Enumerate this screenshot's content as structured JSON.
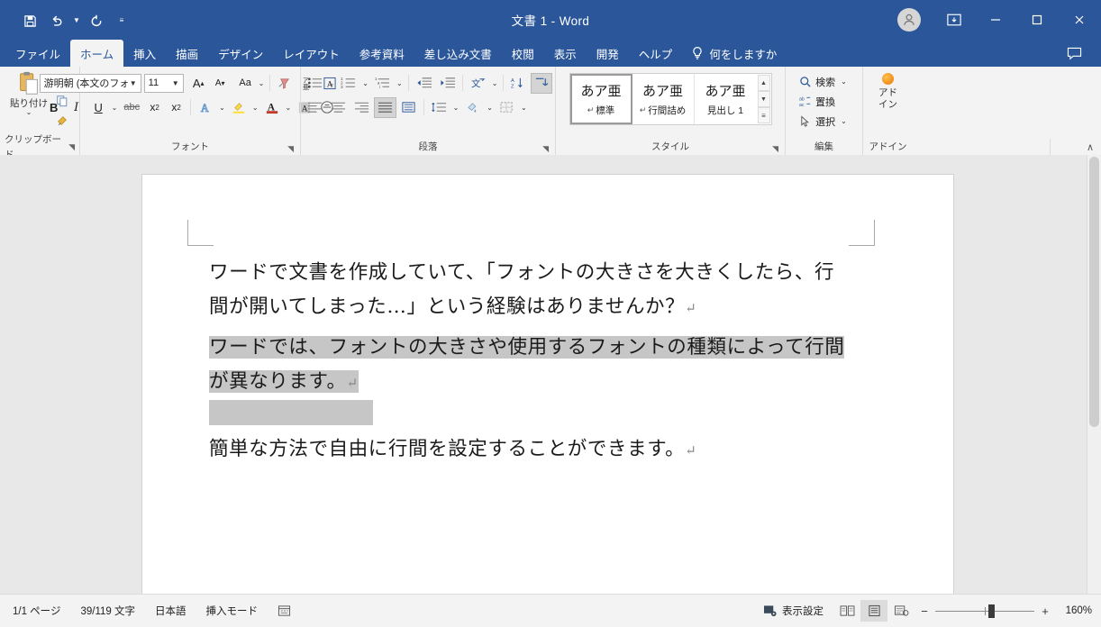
{
  "window": {
    "title": "文書 1  -  Word",
    "quick_access": [
      {
        "name": "save",
        "icon": "save-icon"
      },
      {
        "name": "undo",
        "icon": "undo-icon"
      },
      {
        "name": "redo",
        "icon": "redo-icon"
      },
      {
        "name": "customize",
        "icon": "qat-more-icon"
      }
    ],
    "account_icon": "account-avatar-icon",
    "ribbon_display_icon": "ribbon-display-options-icon",
    "minimize_icon": "minimize-icon",
    "maximize_icon": "maximize-icon",
    "close_icon": "close-icon",
    "comments_icon": "comments-icon"
  },
  "tabs": [
    {
      "label": "ファイル",
      "active": false
    },
    {
      "label": "ホーム",
      "active": true
    },
    {
      "label": "挿入",
      "active": false
    },
    {
      "label": "描画",
      "active": false
    },
    {
      "label": "デザイン",
      "active": false
    },
    {
      "label": "レイアウト",
      "active": false
    },
    {
      "label": "参考資料",
      "active": false
    },
    {
      "label": "差し込み文書",
      "active": false
    },
    {
      "label": "校閲",
      "active": false
    },
    {
      "label": "表示",
      "active": false
    },
    {
      "label": "開発",
      "active": false
    },
    {
      "label": "ヘルプ",
      "active": false
    }
  ],
  "tell_me": {
    "label": "何をしますか",
    "icon": "lightbulb-icon"
  },
  "ribbon": {
    "collapse_label": "∧",
    "groups": {
      "clipboard": {
        "label": "クリップボード",
        "paste_label": "貼り付け",
        "paste_caret": "⌄",
        "buttons": [
          {
            "name": "cut",
            "icon": "scissors-icon"
          },
          {
            "name": "copy",
            "icon": "copy-icon"
          },
          {
            "name": "format-painter",
            "icon": "format-painter-icon"
          }
        ]
      },
      "font": {
        "label": "フォント",
        "font_name": "游明朝 (本文のフォン",
        "font_size": "11",
        "grow_font": "A",
        "shrink_font": "A",
        "change_case": "Aa",
        "clear_formatting": "clear-formatting-icon",
        "phonetic_guide": "phonetic-guide-icon",
        "character_border": "A",
        "bold": "B",
        "italic": "I",
        "underline": "U",
        "strikethrough": "abc",
        "subscript": "x₂",
        "superscript": "x²",
        "text_effects": "A",
        "highlight": "text-highlight-icon",
        "font_color": "A",
        "character_shading": "A",
        "enclose_characters": "enclose-characters-icon"
      },
      "paragraph": {
        "label": "段落",
        "bullets": "bullet-list-icon",
        "numbering": "numbered-list-icon",
        "multilevel": "multilevel-list-icon",
        "decrease_indent": "decrease-indent-icon",
        "increase_indent": "increase-indent-icon",
        "asian_layout": "asian-layout-icon",
        "sort": "sort-icon",
        "show_marks": "show-formatting-marks-icon",
        "align_left": "align-left-icon",
        "align_center": "align-center-icon",
        "align_right": "align-right-icon",
        "justify": "justify-icon",
        "distribute": "distribute-icon",
        "line_spacing": "line-spacing-icon",
        "shading": "shading-icon",
        "borders": "borders-icon"
      },
      "styles": {
        "label": "スタイル",
        "items": [
          {
            "preview": "あア亜",
            "name": "標準",
            "pilcrow": "↵",
            "active": true
          },
          {
            "preview": "あア亜",
            "name": "行間詰め",
            "pilcrow": "↵",
            "active": false
          },
          {
            "preview": "あア亜",
            "name": "見出し 1",
            "pilcrow": "",
            "active": false
          }
        ],
        "scroll_up": "▲",
        "scroll_down": "▼",
        "scroll_more": "▤"
      },
      "editing": {
        "label": "編集",
        "items": [
          {
            "label": "検索",
            "icon": "search-icon",
            "caret": "⌄"
          },
          {
            "label": "置換",
            "icon": "replace-icon",
            "caret": ""
          },
          {
            "label": "選択",
            "icon": "select-cursor-icon",
            "caret": "⌄"
          }
        ]
      },
      "addin": {
        "label": "アドイン",
        "button_line1": "アド",
        "button_line2": "イン",
        "icon": "addin-orange-dot-icon"
      }
    }
  },
  "document": {
    "paragraphs": [
      {
        "lines": [
          {
            "text": "ワードで文書を作成していて、「フォントの大きさを大きくしたら、行",
            "highlighted": false
          },
          {
            "text": "間が開いてしまった…」という経験はありませんか？",
            "highlighted": false
          }
        ],
        "pilcrow": "↵",
        "highlighted": false
      },
      {
        "lines": [
          {
            "text": "ワードでは、フォントの大きさや使用するフォントの種類によって行間",
            "highlighted": true
          },
          {
            "text": "が異なります。",
            "highlighted": true
          }
        ],
        "pilcrow": "↵",
        "highlighted": true
      },
      {
        "lines": [
          {
            "text": "簡単な方法で自由に行間を設定することができます。",
            "highlighted": false
          }
        ],
        "pilcrow": "↵",
        "highlighted": false
      }
    ]
  },
  "status_bar": {
    "page": "1/1 ページ",
    "words": "39/119 文字",
    "language": "日本語",
    "mode": "挿入モード",
    "proofing_icon": "proofing-icon",
    "view_settings": "表示設定",
    "view_settings_icon": "view-settings-icon",
    "views": [
      {
        "name": "read-mode",
        "icon": "read-mode-icon",
        "active": false
      },
      {
        "name": "print-layout",
        "icon": "print-layout-icon",
        "active": true
      },
      {
        "name": "web-layout",
        "icon": "web-layout-icon",
        "active": false
      }
    ],
    "zoom_out": "−",
    "zoom_in": "+",
    "zoom_value": "160%"
  },
  "colors": {
    "titlebar": "#2b579a",
    "ribbon": "#f3f3f3",
    "workspace": "#e8e8e8",
    "selection": "#c6c6c6",
    "accent_red": "#c0392b",
    "accent_blue": "#2b579a"
  }
}
